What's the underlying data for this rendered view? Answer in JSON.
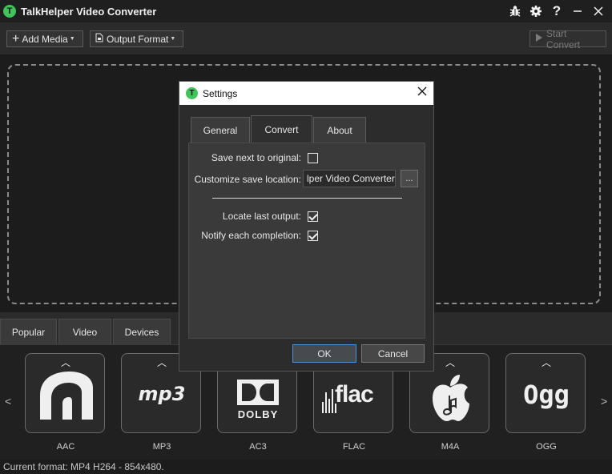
{
  "app": {
    "title": "TalkHelper Video Converter",
    "logo_letter": "T"
  },
  "title_icons": [
    "bug-icon",
    "gear-icon",
    "help-icon",
    "minimize-icon",
    "close-icon"
  ],
  "toolbar": {
    "add_media": "Add Media",
    "output_format": "Output Format",
    "start_convert": "Start Convert"
  },
  "tabs": [
    "Popular",
    "Video",
    "Devices"
  ],
  "formats": [
    {
      "label": "AAC",
      "icon": "aac-icon"
    },
    {
      "label": "MP3",
      "icon": "mp3-icon",
      "logo_text": "mp3"
    },
    {
      "label": "AC3",
      "icon": "dolby-icon",
      "logo_text": "DOLBY"
    },
    {
      "label": "FLAC",
      "icon": "flac-icon",
      "logo_text": "flac"
    },
    {
      "label": "M4A",
      "icon": "apple-music-icon"
    },
    {
      "label": "OGG",
      "icon": "ogg-icon",
      "logo_text": "Ogg"
    }
  ],
  "status": "Current format: MP4 H264 - 854x480.",
  "dialog": {
    "title": "Settings",
    "tabs": [
      "General",
      "Convert",
      "About"
    ],
    "active_tab": "Convert",
    "save_next_to_original": {
      "label": "Save next to original:",
      "checked": false
    },
    "customize_save_location": {
      "label": "Customize save location:",
      "value": "lper Video Converter",
      "browse": "..."
    },
    "locate_last_output": {
      "label": "Locate last output:",
      "checked": true
    },
    "notify_each_completion": {
      "label": "Notify each completion:",
      "checked": true
    },
    "ok": "OK",
    "cancel": "Cancel"
  },
  "colors": {
    "accent_green": "#3ec45a",
    "background": "#1e1e1e",
    "ok_border": "#4a90d9"
  }
}
